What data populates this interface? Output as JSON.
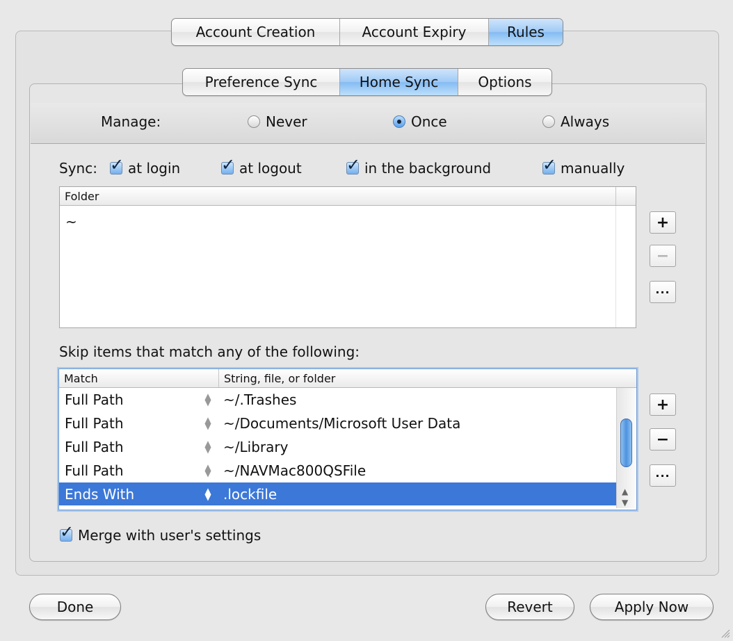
{
  "top_tabs": [
    {
      "label": "Account Creation",
      "selected": false
    },
    {
      "label": "Account Expiry",
      "selected": false
    },
    {
      "label": "Rules",
      "selected": true
    }
  ],
  "sub_tabs": [
    {
      "label": "Preference Sync",
      "selected": false
    },
    {
      "label": "Home Sync",
      "selected": true
    },
    {
      "label": "Options",
      "selected": false
    }
  ],
  "manage": {
    "label": "Manage:",
    "options": [
      {
        "label": "Never",
        "selected": false
      },
      {
        "label": "Once",
        "selected": true
      },
      {
        "label": "Always",
        "selected": false
      }
    ]
  },
  "sync": {
    "label": "Sync:",
    "options": [
      {
        "label": "at login",
        "checked": true
      },
      {
        "label": "at logout",
        "checked": true
      },
      {
        "label": "in the background",
        "checked": true
      },
      {
        "label": "manually",
        "checked": true
      }
    ]
  },
  "folder_table": {
    "header": "Folder",
    "rows": [
      "~"
    ]
  },
  "folder_buttons": {
    "add": "+",
    "remove": "−",
    "more": "···"
  },
  "skip": {
    "label": "Skip items that match any of the following:",
    "headers": [
      "Match",
      "String, file, or folder"
    ],
    "rows": [
      {
        "match": "Full Path",
        "value": "~/.Trashes",
        "selected": false
      },
      {
        "match": "Full Path",
        "value": "~/Documents/Microsoft User Data",
        "selected": false
      },
      {
        "match": "Full Path",
        "value": "~/Library",
        "selected": false
      },
      {
        "match": "Full Path",
        "value": "~/NAVMac800QSFile",
        "selected": false
      },
      {
        "match": "Ends With",
        "value": ".lockfile",
        "selected": true
      }
    ]
  },
  "skip_buttons": {
    "add": "+",
    "remove": "−",
    "more": "···"
  },
  "merge": {
    "label": "Merge with user's settings",
    "checked": true
  },
  "bottom_buttons": {
    "done": "Done",
    "revert": "Revert",
    "apply": "Apply Now"
  },
  "glyphs": {
    "check": "✓",
    "stepper_up": "▲",
    "stepper_down": "▼",
    "scroll_up": "▲",
    "scroll_down": "▼"
  }
}
